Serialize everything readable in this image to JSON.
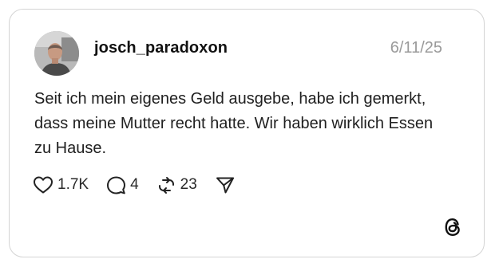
{
  "post": {
    "username": "josch_paradoxon",
    "date": "6/11/25",
    "text": "Seit ich mein eigenes Geld ausgebe, habe ich gemerkt, dass meine Mutter recht hatte. Wir haben wirklich Essen zu Hause.",
    "avatar_icon": "profile-photo",
    "actions": {
      "like": {
        "icon": "heart-icon",
        "count": "1.7K"
      },
      "reply": {
        "icon": "comment-icon",
        "count": "4"
      },
      "repost": {
        "icon": "repost-icon",
        "count": "23"
      },
      "share": {
        "icon": "send-icon"
      }
    }
  },
  "branding": {
    "icon": "threads-logo-icon"
  },
  "colors": {
    "card_border": "#d4d4d4",
    "date_text": "#9a9a9a",
    "primary_text": "#111111"
  }
}
